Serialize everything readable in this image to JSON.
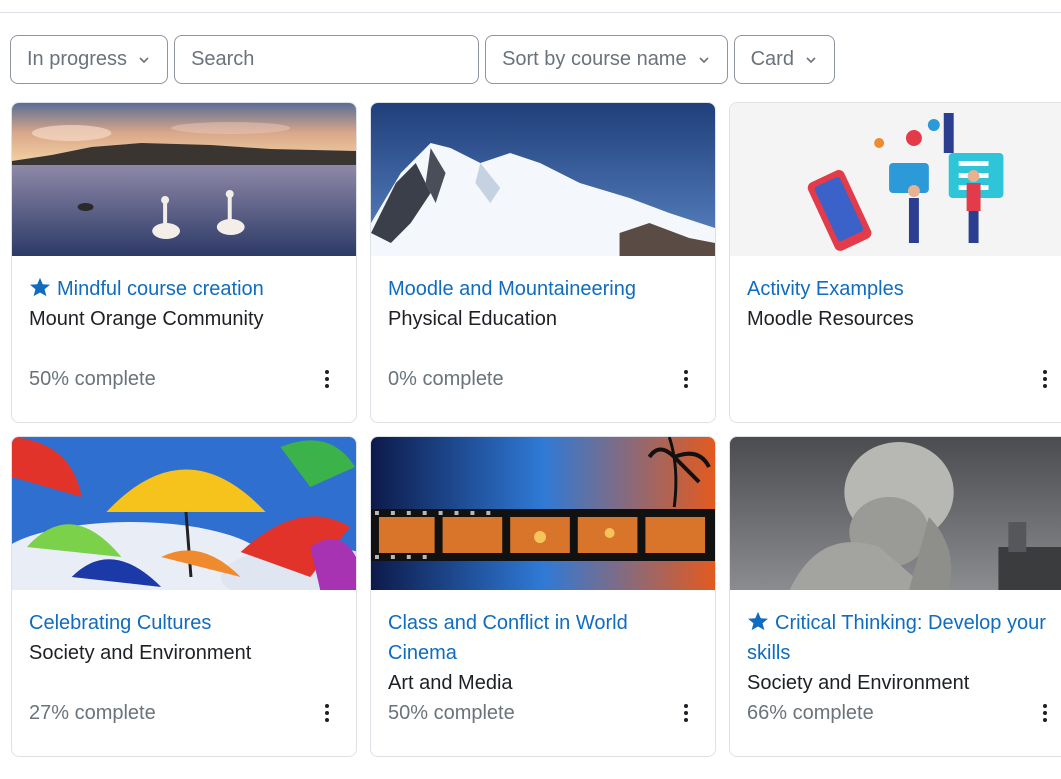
{
  "filters": {
    "status": "In progress",
    "search_placeholder": "Search",
    "sort": "Sort by course name",
    "view": "Card"
  },
  "colors": {
    "link": "#0f6cbf",
    "muted": "#6a737b",
    "border": "#dee2e6"
  },
  "courses": [
    {
      "title": "Mindful course creation",
      "category": "Mount Orange Community",
      "progress": "50% complete",
      "starred": true,
      "image": "lake-swans"
    },
    {
      "title": "Moodle and Mountaineering",
      "category": "Physical Education",
      "progress": "0% complete",
      "starred": false,
      "image": "snowy-mountain"
    },
    {
      "title": "Activity Examples",
      "category": "Moodle Resources",
      "progress": "",
      "starred": false,
      "image": "phone-illustration"
    },
    {
      "title": "Celebrating Cultures",
      "category": "Society and Environment",
      "progress": "27% complete",
      "starred": false,
      "image": "umbrellas"
    },
    {
      "title": "Class and Conflict in World Cinema",
      "category": "Art and Media",
      "progress": "50% complete",
      "starred": false,
      "image": "film-strip"
    },
    {
      "title": "Critical Thinking: Develop your skills",
      "category": "Society and Environment",
      "progress": "66% complete",
      "starred": true,
      "image": "thinker-statue"
    }
  ]
}
